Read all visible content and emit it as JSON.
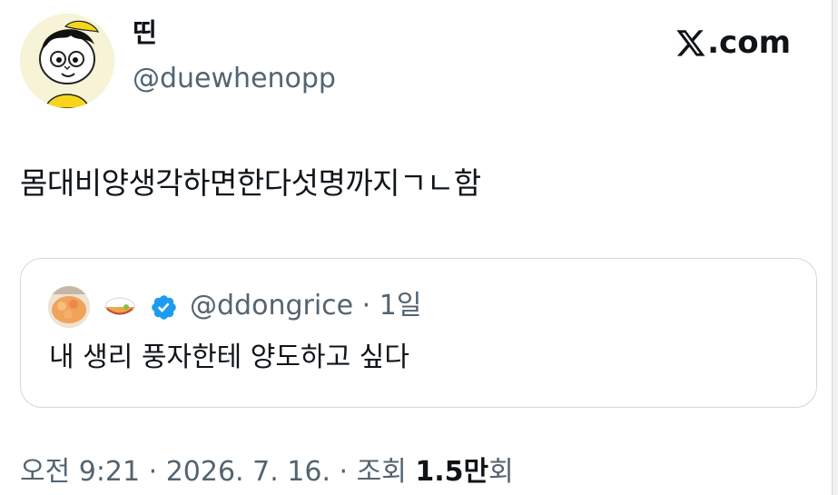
{
  "tweet": {
    "display_name": "띤",
    "handle": "@duewhenopp",
    "text": "몸대비양생각하면한다섯명까지ㄱㄴ함",
    "timestamp": "오전 9:21 · 2026. 7. 16. · 조회 ",
    "views_count": "1.5만",
    "views_suffix": "회",
    "avatar_icon": "cartoon-avatar-icon"
  },
  "brand": {
    "logo_icon": "x-logo-icon",
    "domain_text": ".com"
  },
  "quote": {
    "handle": "@ddongrice",
    "meta": " · 1일",
    "text": "내 생리 풍자한테 양도하고 싶다",
    "verified_color": "#1d9bf0",
    "name_icon": "rice-bowl-emoji-icon",
    "avatar_icon": "food-photo-avatar-icon"
  },
  "colors": {
    "text_primary": "#0f1419",
    "text_secondary": "#536471",
    "border": "#cfd9de",
    "verified": "#1d9bf0"
  }
}
